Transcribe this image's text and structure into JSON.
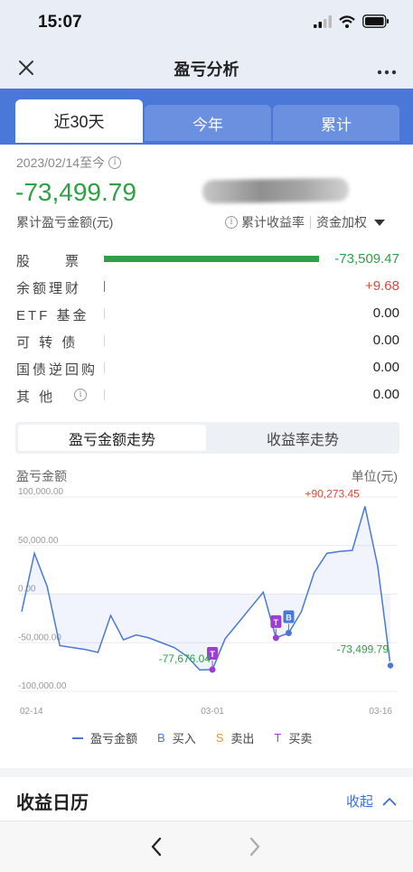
{
  "status_bar": {
    "time": "15:07"
  },
  "nav": {
    "title": "盈亏分析"
  },
  "tabs": [
    {
      "label": "近30天",
      "active": true
    },
    {
      "label": "今年",
      "active": false
    },
    {
      "label": "累计",
      "active": false
    }
  ],
  "summary": {
    "date_range": "2023/02/14至今",
    "total_value": "-73,499.79",
    "total_label": "累计盈亏金额(元)",
    "return_rate_label": "累计收益率",
    "weighting_label": "资金加权"
  },
  "assets": [
    {
      "label": "股　　票",
      "value": "-73,509.47",
      "bar": 1.0,
      "color": "#2ea046",
      "info": false
    },
    {
      "label": "余额理财",
      "value": "+9.68",
      "bar": 0.0,
      "color": "#d94a3a",
      "info": false
    },
    {
      "label": "ETF 基金",
      "value": "0.00",
      "bar": 0.0,
      "color": "#222222",
      "info": false
    },
    {
      "label": "可 转 债",
      "value": "0.00",
      "bar": 0.0,
      "color": "#222222",
      "info": false
    },
    {
      "label": "国债逆回购",
      "value": "0.00",
      "bar": 0.0,
      "color": "#222222",
      "info": false
    },
    {
      "label": "其 他",
      "value": "0.00",
      "bar": 0.0,
      "color": "#222222",
      "info": true
    }
  ],
  "trend_toggle": {
    "amount": "盈亏金额走势",
    "rate": "收益率走势"
  },
  "chart_header": {
    "left": "盈亏金额",
    "right": "单位(元)"
  },
  "chart_data": {
    "type": "line",
    "ylabel": "盈亏金额",
    "unit": "单位(元)",
    "ylim": [
      -100000,
      100000
    ],
    "yticks": [
      "100,000.00",
      "50,000.00",
      "0.00",
      "-50,000.00",
      "-100,000.00"
    ],
    "ytick_values": [
      100000,
      50000,
      0,
      -50000,
      -100000
    ],
    "xticks": [
      "02-14",
      "03-01",
      "03-16"
    ],
    "series": [
      {
        "name": "盈亏金额",
        "color": "#4a78d8",
        "values": [
          -18000,
          42000,
          8000,
          -53000,
          -55000,
          -57000,
          -60000,
          -22000,
          -47000,
          -42000,
          -45000,
          -50000,
          -55000,
          -64000,
          -78000,
          -77676,
          -46000,
          -30000,
          -14000,
          2000,
          -45000,
          -40000,
          -18000,
          22000,
          42000,
          44000,
          45000,
          90273,
          29000,
          -73500
        ]
      }
    ],
    "annotations": [
      {
        "label": "+90,273.45",
        "index": 27,
        "color": "#d94a3a"
      },
      {
        "label": "-77,676.04",
        "index": 15,
        "color": "#2ea046"
      },
      {
        "label": "-73,499.79",
        "index": 29,
        "color": "#2ea046"
      }
    ],
    "trade_markers": [
      {
        "type": "T",
        "index": 15
      },
      {
        "type": "T",
        "index": 20
      },
      {
        "type": "B",
        "index": 21
      }
    ],
    "legend": [
      {
        "label": "盈亏金额",
        "symbol": "line",
        "color": "#4a78d8"
      },
      {
        "label": "买入",
        "symbol": "B",
        "color": "#4a78d8"
      },
      {
        "label": "卖出",
        "symbol": "S",
        "color": "#e39a33"
      },
      {
        "label": "买卖",
        "symbol": "T",
        "color": "#9b3fd0"
      }
    ]
  },
  "calendar": {
    "title": "收益日历",
    "toggle": "收起"
  }
}
